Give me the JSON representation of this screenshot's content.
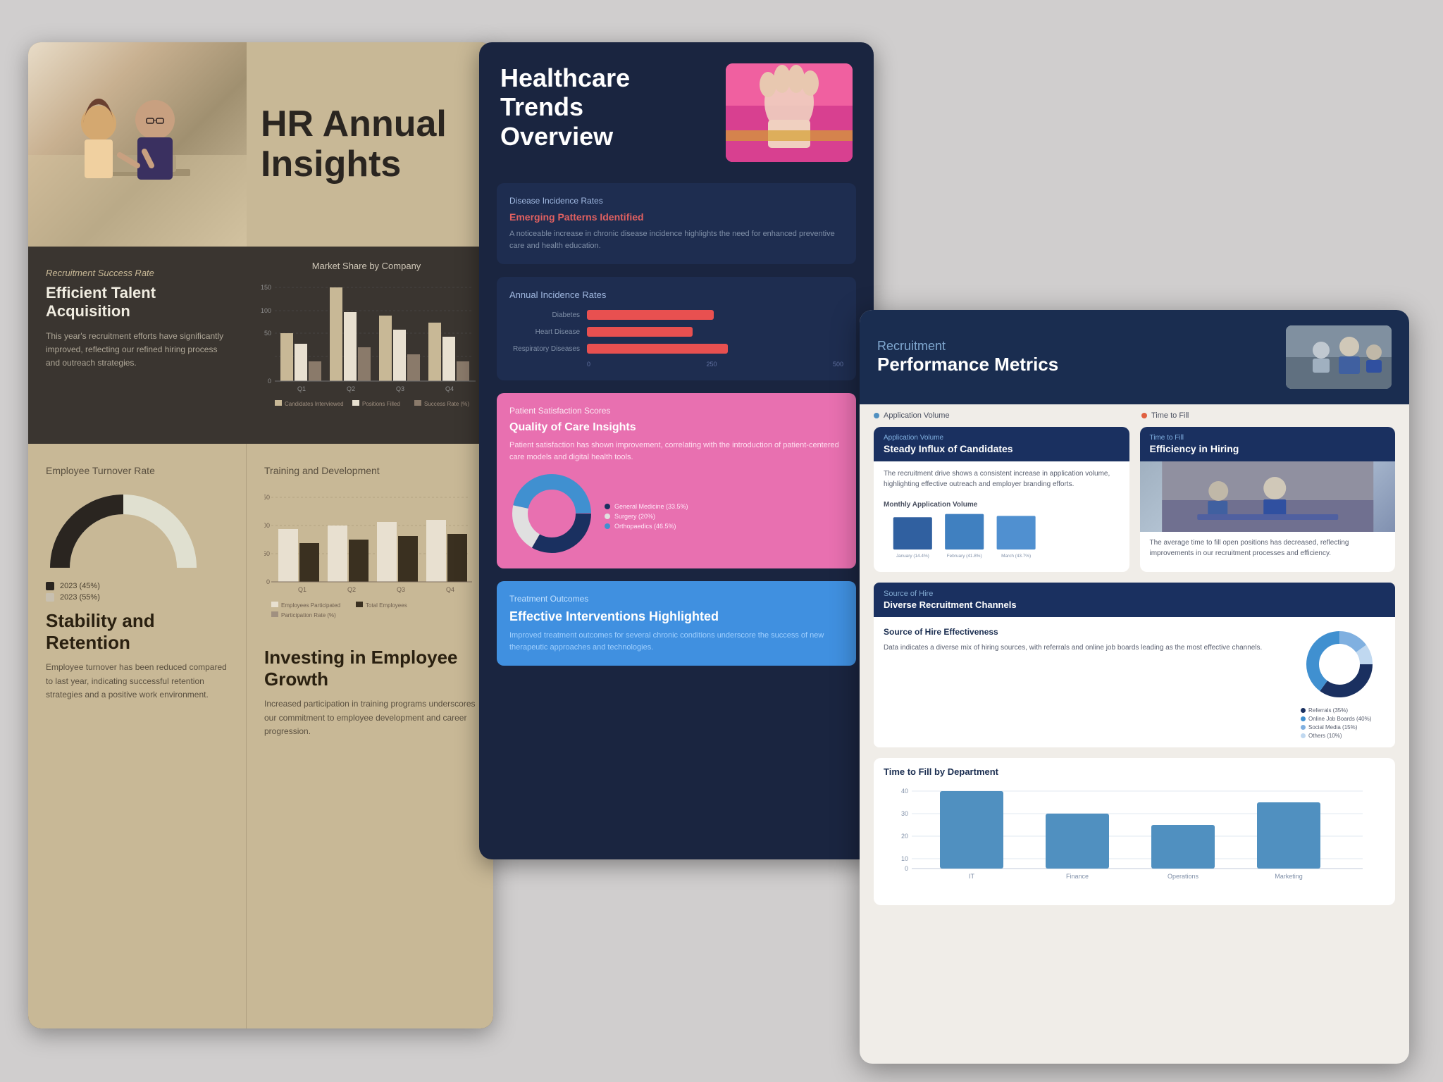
{
  "hr_slide": {
    "title": "HR Annual Insights",
    "hero_photo_alt": "Team meeting photo",
    "recruitment": {
      "label": "Recruitment Success Rate",
      "title": "Efficient Talent Acquisition",
      "body": "This year's recruitment efforts have significantly improved, reflecting our refined hiring process and outreach strategies.",
      "chart_title": "Market Share by Company",
      "chart_quarters": [
        "Q1",
        "Q2",
        "Q3",
        "Q4"
      ],
      "chart_legend": [
        "Candidates Interviewed",
        "Positions Filled",
        "Success Rate (%)"
      ],
      "chart_y_max": 150,
      "chart_y_labels": [
        "150",
        "100",
        "50",
        "0"
      ]
    },
    "turnover": {
      "label": "Employee Turnover Rate",
      "legend": [
        "2023 (45%)",
        "2023 (55%)"
      ],
      "title": "Stability and Retention",
      "body": "Employee turnover has been reduced compared to last year, indicating successful retention strategies and a positive work environment."
    },
    "training": {
      "label": "Training and Development",
      "title": "Investing in Employee Growth",
      "body": "Increased participation in training programs underscores our commitment to employee development and career progression.",
      "chart_quarters": [
        "Q1",
        "Q2",
        "Q3",
        "Q4"
      ],
      "chart_legend": [
        "Employees Participated",
        "Total Employees",
        "Participation Rate (%)"
      ]
    }
  },
  "health_slide": {
    "title": "Healthcare\nTrends\nOverview",
    "photo_alt": "Medical procedure photo",
    "disease_card": {
      "label": "Disease Incidence Rates",
      "highlight": "Emerging Patterns Identified",
      "body": "A noticeable increase in chronic disease incidence highlights the need for enhanced preventive care and health education."
    },
    "incidence_chart": {
      "title": "Annual Incidence Rates",
      "rows": [
        {
          "label": "Diabetes",
          "width_pct": 72
        },
        {
          "label": "Heart Disease",
          "width_pct": 60
        },
        {
          "label": "Respiratory Diseases",
          "width_pct": 80
        }
      ],
      "axis_labels": [
        "0",
        "250",
        "500"
      ]
    },
    "patient_card": {
      "label": "Patient Satisfaction Scores",
      "title": "Quality of Care Insights",
      "body": "Patient satisfaction has shown improvement, correlating with the introduction of patient-centered care models and digital health tools.",
      "donut_segments": [
        {
          "label": "General Medicine (33.5%)",
          "color": "#1a3060",
          "pct": 33.5
        },
        {
          "label": "Surgery (20%)",
          "color": "#e0e0e0",
          "pct": 20
        },
        {
          "label": "Orthopaedics (46.5%)",
          "color": "#4090d0",
          "pct": 46.5
        }
      ]
    },
    "treatment_card": {
      "label": "Treatment Outcomes",
      "title": "Effective Interventions Highlighted",
      "body": "Improved treatment outcomes for several chronic conditions underscore the success of new therapeutic approaches and technologies."
    }
  },
  "recruit_slide": {
    "subtitle": "Recruitment",
    "title": "Performance Metrics",
    "photo_alt": "Office team photo",
    "application_volume": {
      "metric_label": "Application Volume",
      "card_label": "Steady Influx of Candidates",
      "card_body": "The recruitment drive shows a consistent increase in application volume, highlighting effective outreach and employer branding efforts.",
      "chart_title": "Monthly Application Volume",
      "months": [
        "January (14.4%)",
        "February (41.8%)",
        "March (43.7%)"
      ],
      "bar_colors": [
        "#5090c0",
        "#4080b0",
        "#3070a0"
      ]
    },
    "time_to_fill": {
      "metric_label": "Time to Fill",
      "card_label": "Efficiency in Hiring",
      "card_body": "The average time to fill open positions has decreased, reflecting improvements in our recruitment processes and efficiency.",
      "photo_alt": "Hiring team photo"
    },
    "source_of_hire": {
      "section_label": "Source of Hire",
      "card_label": "Diverse Recruitment Channels",
      "card_body": "Data indicates a diverse mix of hiring sources, with referrals and online job boards leading as the most effective channels.",
      "chart_title": "Source of Hire Effectiveness",
      "segments": [
        {
          "label": "Referrals (35%)",
          "color": "#1a3060",
          "pct": 35
        },
        {
          "label": "Online Job Boards (40%)",
          "color": "#4090d0",
          "pct": 40
        },
        {
          "label": "Social Media (15%)",
          "color": "#80b0e0",
          "pct": 15
        },
        {
          "label": "Others (10%)",
          "color": "#c0d8f0",
          "pct": 10
        }
      ]
    },
    "time_by_dept": {
      "title": "Time to Fill by Department",
      "departments": [
        "IT",
        "Finance",
        "Operations",
        "Marketing"
      ],
      "values": [
        38,
        28,
        22,
        32
      ],
      "y_labels": [
        "40",
        "30",
        "20",
        "10",
        "0"
      ]
    }
  }
}
